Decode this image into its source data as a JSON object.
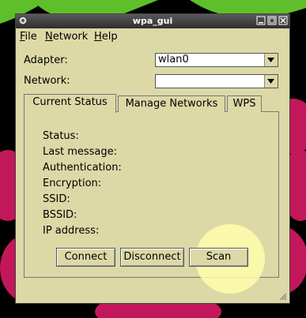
{
  "window": {
    "title": "wpa_gui"
  },
  "menu": [
    {
      "label": "File",
      "underline": "F",
      "rest": "ile"
    },
    {
      "label": "Network",
      "underline": "N",
      "rest": "etwork"
    },
    {
      "label": "Help",
      "underline": "H",
      "rest": "elp"
    }
  ],
  "adapter": {
    "label": "Adapter:",
    "value": "wlan0"
  },
  "network": {
    "label": "Network:",
    "value": ""
  },
  "tabs": [
    "Current Status",
    "Manage Networks",
    "WPS"
  ],
  "status": {
    "status": "Status:",
    "last_message": "Last message:",
    "authentication": "Authentication:",
    "encryption": "Encryption:",
    "ssid": "SSID:",
    "bssid": "BSSID:",
    "ip_address": "IP address:"
  },
  "buttons": {
    "connect": "Connect",
    "disconnect": "Disconnect",
    "scan": "Scan"
  },
  "colors": {
    "window_bg": "#dcd9a7",
    "wallpaper_green": "#5fbf2a",
    "wallpaper_red": "#c2185b",
    "highlight": "#fffdaa"
  },
  "icons": {
    "app": "app-icon",
    "minimize": "minimize-icon",
    "maximize": "maximize-icon",
    "close": "close-icon"
  }
}
